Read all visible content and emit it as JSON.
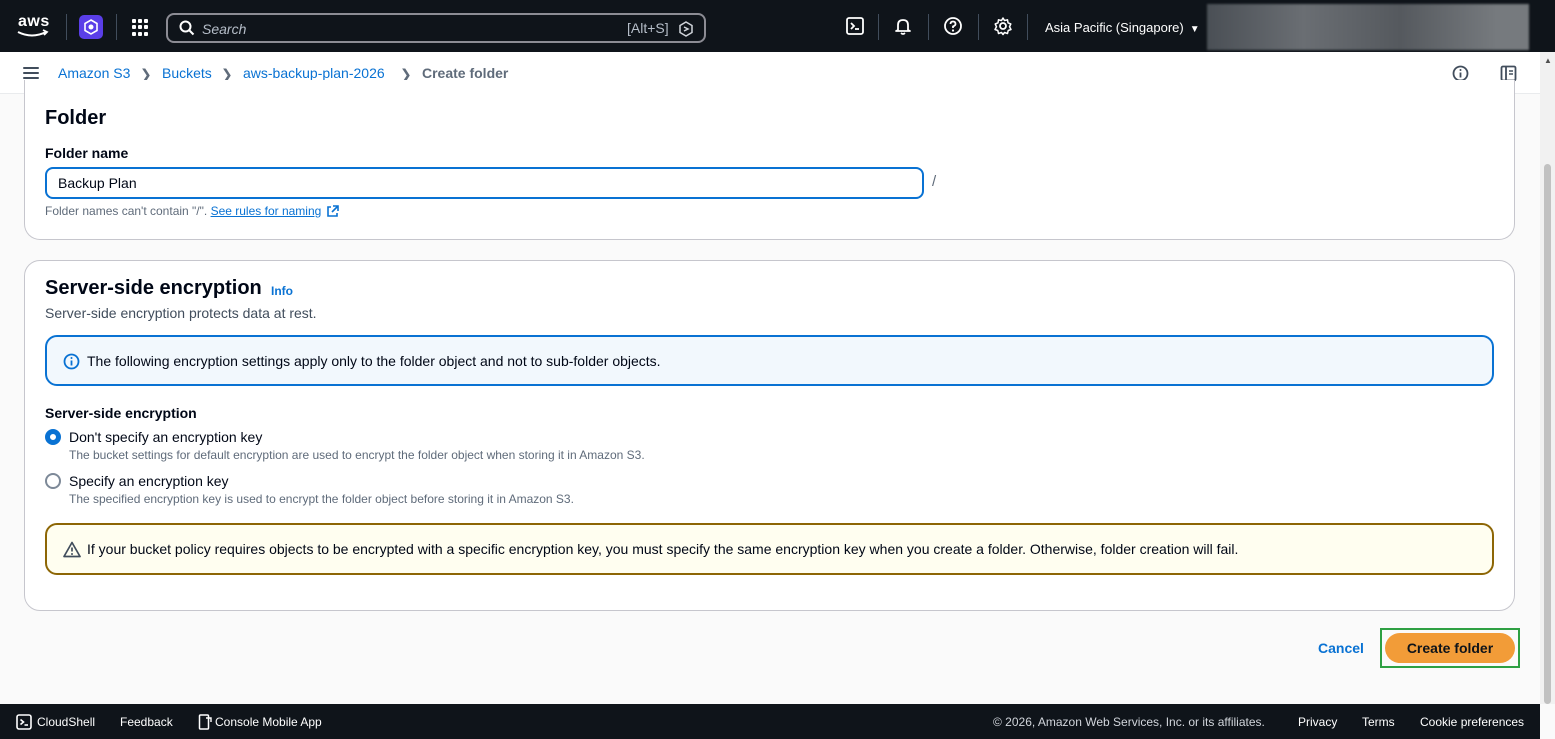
{
  "topnav": {
    "logo_text": "aws",
    "search_placeholder": "Search",
    "search_shortcut": "[Alt+S]",
    "region": "Asia Pacific (Singapore)",
    "icons": [
      "cloudshell-icon",
      "bell-icon",
      "help-icon",
      "gear-icon"
    ]
  },
  "breadcrumb": {
    "items": [
      {
        "label": "Amazon S3"
      },
      {
        "label": "Buckets"
      },
      {
        "label": "aws-backup-plan-2026"
      }
    ],
    "current": "Create folder"
  },
  "folder": {
    "title": "Folder",
    "name_label": "Folder name",
    "name_value": "Backup Plan",
    "slash": "/",
    "hint_text": "Folder names can't contain \"/\".",
    "hint_link": "See rules for naming"
  },
  "encryption": {
    "title": "Server-side encryption",
    "info_link": "Info",
    "description": "Server-side encryption protects data at rest.",
    "info_alert": "The following encryption settings apply only to the folder object and not to sub-folder objects.",
    "group_label": "Server-side encryption",
    "options": [
      {
        "label": "Don't specify an encryption key",
        "desc": "The bucket settings for default encryption are used to encrypt the folder object when storing it in Amazon S3.",
        "selected": true
      },
      {
        "label": "Specify an encryption key",
        "desc": "The specified encryption key is used to encrypt the folder object before storing it in Amazon S3.",
        "selected": false
      }
    ],
    "warning": "If your bucket policy requires objects to be encrypted with a specific encryption key, you must specify the same encryption key when you create a folder. Otherwise, folder creation will fail."
  },
  "actions": {
    "cancel": "Cancel",
    "create": "Create folder"
  },
  "footer": {
    "cloudshell": "CloudShell",
    "feedback": "Feedback",
    "mobile_app": "Console Mobile App",
    "copyright": "© 2026, Amazon Web Services, Inc. or its affiliates.",
    "privacy": "Privacy",
    "terms": "Terms",
    "cookie": "Cookie preferences"
  },
  "colors": {
    "nav_bg": "#0f141a",
    "link": "#0972d3",
    "primary_button": "#f29c38",
    "highlight_border": "#2ea043"
  }
}
